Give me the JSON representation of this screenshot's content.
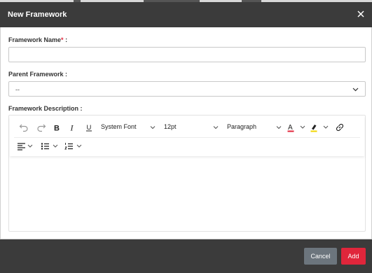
{
  "dialog": {
    "title": "New Framework"
  },
  "form": {
    "name_label": "Framework Name",
    "required_mark": "*",
    "name_suffix": " :",
    "name_value": "",
    "parent_label": "Parent Framework :",
    "parent_value": "--",
    "description_label": "Framework Description :"
  },
  "editor": {
    "font_family": "System Font",
    "font_size": "12pt",
    "block_format": "Paragraph",
    "text_color": "#e0263b",
    "highlight_color": "#f2d600",
    "icons": [
      "undo-icon",
      "redo-icon",
      "bold-icon",
      "italic-icon",
      "underline-icon",
      "text-color-icon",
      "highlight-icon",
      "link-icon",
      "align-left-icon",
      "bullet-list-icon",
      "numbered-list-icon"
    ]
  },
  "footer": {
    "cancel_label": "Cancel",
    "add_label": "Add"
  },
  "colors": {
    "header_bg": "#3b3b3b",
    "accent": "#e0263b",
    "cancel_bg": "#6c757d"
  }
}
